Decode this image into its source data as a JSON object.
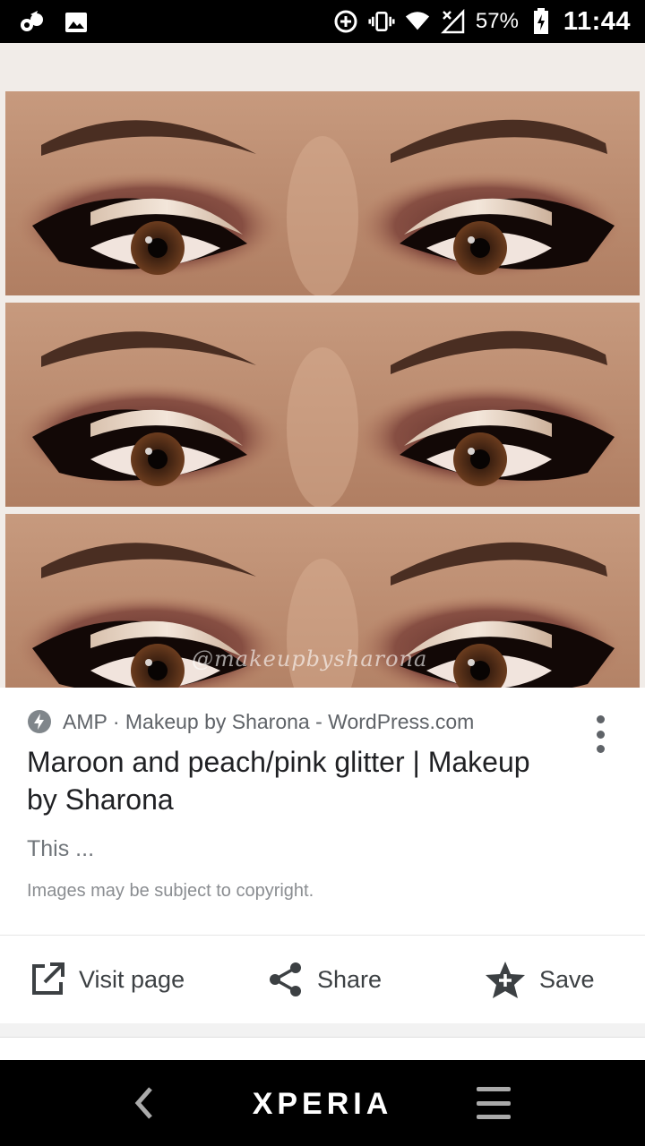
{
  "status_bar": {
    "battery_percent": "57%",
    "time": "11:44",
    "icons": [
      "notification-app-icon",
      "gallery-icon",
      "data-saver-icon",
      "vibrate-icon",
      "wifi-icon",
      "cellular-signal-icon",
      "battery-charging-icon"
    ]
  },
  "image": {
    "watermark": "@makeupbysharona",
    "panels": 3
  },
  "result": {
    "source": "AMP · Makeup by Sharona - WordPress.com",
    "title": "Maroon and peach/pink glitter | Makeup by Sharona",
    "snippet": "This ...",
    "copyright_notice": "Images may be subject to copyright."
  },
  "actions": {
    "visit_label": "Visit page",
    "share_label": "Share",
    "save_label": "Save"
  },
  "nav_bar": {
    "brand": "XPERIA"
  },
  "colors": {
    "status_bar_bg": "#000000",
    "text_primary": "#202124",
    "text_secondary": "#5f6368",
    "nav_bar_bg": "#000000"
  }
}
